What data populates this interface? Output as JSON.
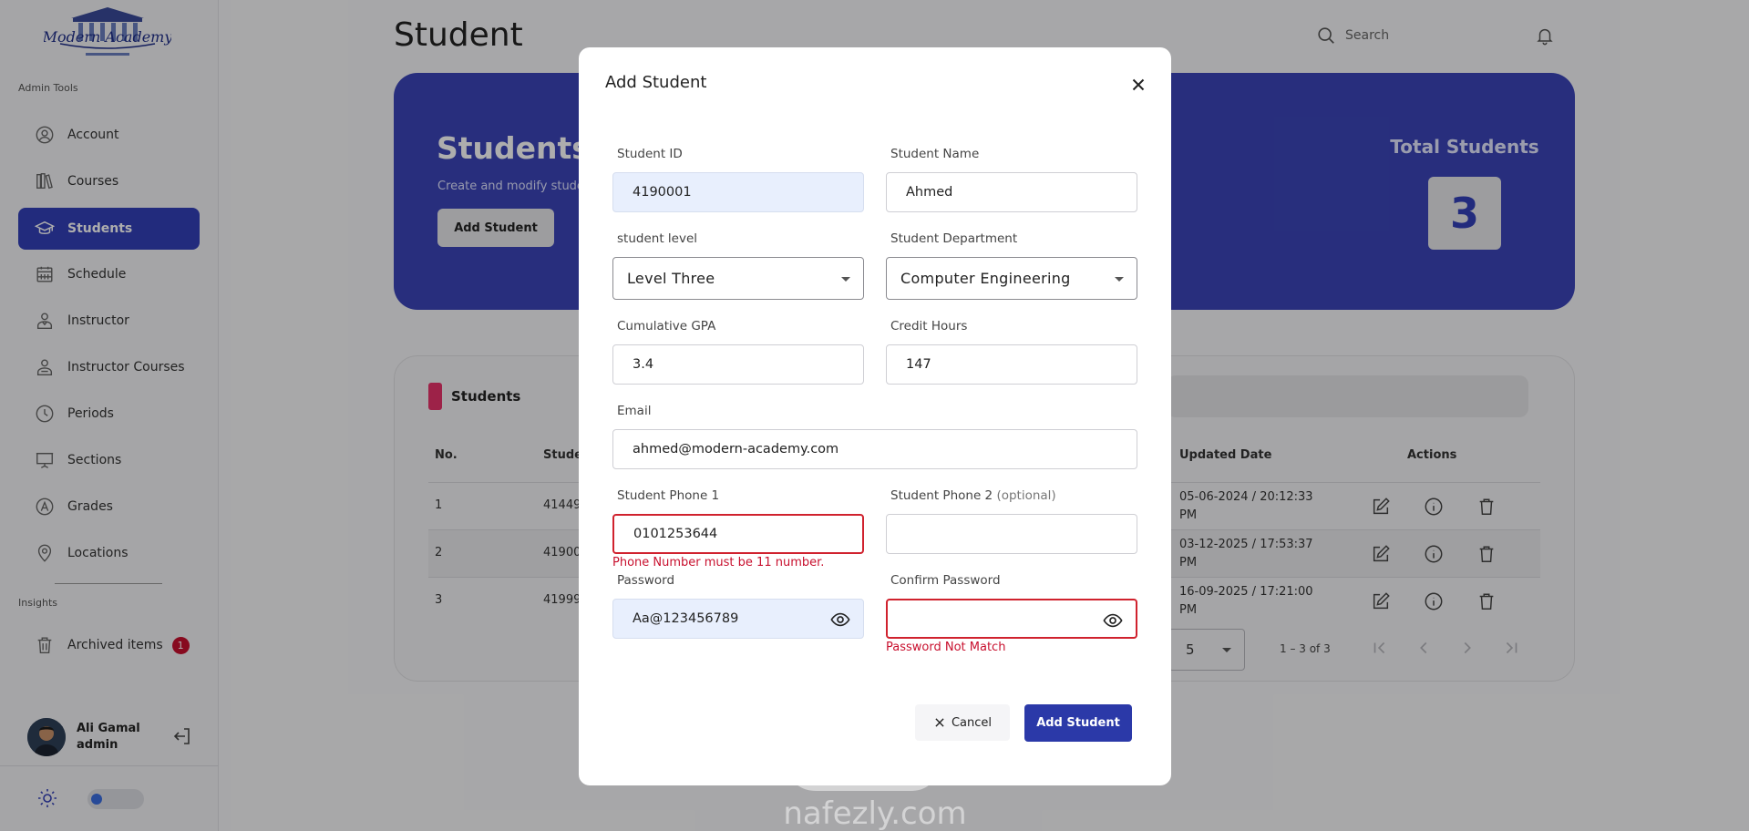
{
  "sidebar": {
    "admin_tools_label": "Admin Tools",
    "insights_label": "Insights",
    "items": [
      {
        "label": "Account",
        "icon": "user-circle-icon"
      },
      {
        "label": "Courses",
        "icon": "books-icon"
      },
      {
        "label": "Students",
        "icon": "graduation-cap-icon",
        "active": true
      },
      {
        "label": "Schedule",
        "icon": "calendar-icon"
      },
      {
        "label": "Instructor",
        "icon": "instructor-icon"
      },
      {
        "label": "Instructor Courses",
        "icon": "instructor-courses-icon"
      },
      {
        "label": "Periods",
        "icon": "clock-icon"
      },
      {
        "label": "Sections",
        "icon": "presentation-board-icon"
      },
      {
        "label": "Grades",
        "icon": "grade-icon"
      },
      {
        "label": "Locations",
        "icon": "location-pin-icon"
      }
    ],
    "archived": {
      "label": "Archived items",
      "count": "1"
    },
    "user": {
      "name": "Ali Gamal",
      "role": "admin"
    }
  },
  "header": {
    "title": "Student",
    "search_placeholder": "Search"
  },
  "banner": {
    "title": "Students",
    "subtitle": "Create and modify stude",
    "add_button": "Add Student",
    "total_label": "Total Students",
    "total_value": "3"
  },
  "table": {
    "title": "Students",
    "columns": {
      "no": "No.",
      "student": "Studen",
      "updated": "Updated Date",
      "actions": "Actions"
    },
    "rows": [
      {
        "no": "1",
        "id": "41449",
        "updated": "05-06-2024 / 20:12:33 PM"
      },
      {
        "no": "2",
        "id": "41900",
        "updated": "03-12-2025 / 17:53:37 PM"
      },
      {
        "no": "3",
        "id": "41999",
        "updated": "16-09-2025 / 17:21:00 PM"
      }
    ],
    "page_size": "5",
    "range": "1 – 3 of 3"
  },
  "modal": {
    "title": "Add Student",
    "student_id": {
      "label": "Student ID",
      "value": "4190001"
    },
    "student_name": {
      "label": "Student Name",
      "value": "Ahmed"
    },
    "level": {
      "label": "student level",
      "value": "Level Three"
    },
    "department": {
      "label": "Student Department",
      "value": "Computer Engineering"
    },
    "gpa": {
      "label": "Cumulative GPA",
      "value": "3.4"
    },
    "credit_hours": {
      "label": "Credit Hours",
      "value": "147"
    },
    "email": {
      "label": "Email",
      "value": "ahmed@modern-academy.com"
    },
    "phone1": {
      "label": "Student Phone 1",
      "value": "0101253644",
      "error": "Phone Number must be 11 number."
    },
    "phone2": {
      "label": "Student Phone 2",
      "optional": "(optional)",
      "value": ""
    },
    "password": {
      "label": "Password",
      "value": "Aa@123456789"
    },
    "confirm_password": {
      "label": "Confirm Password",
      "value": "",
      "error": "Password Not Match"
    },
    "cancel_label": "Cancel",
    "submit_label": "Add Student"
  },
  "colors": {
    "primary": "#3340b8",
    "banner": "#3b45b8",
    "error": "#d0222e",
    "accent_pink": "#e8336a"
  }
}
